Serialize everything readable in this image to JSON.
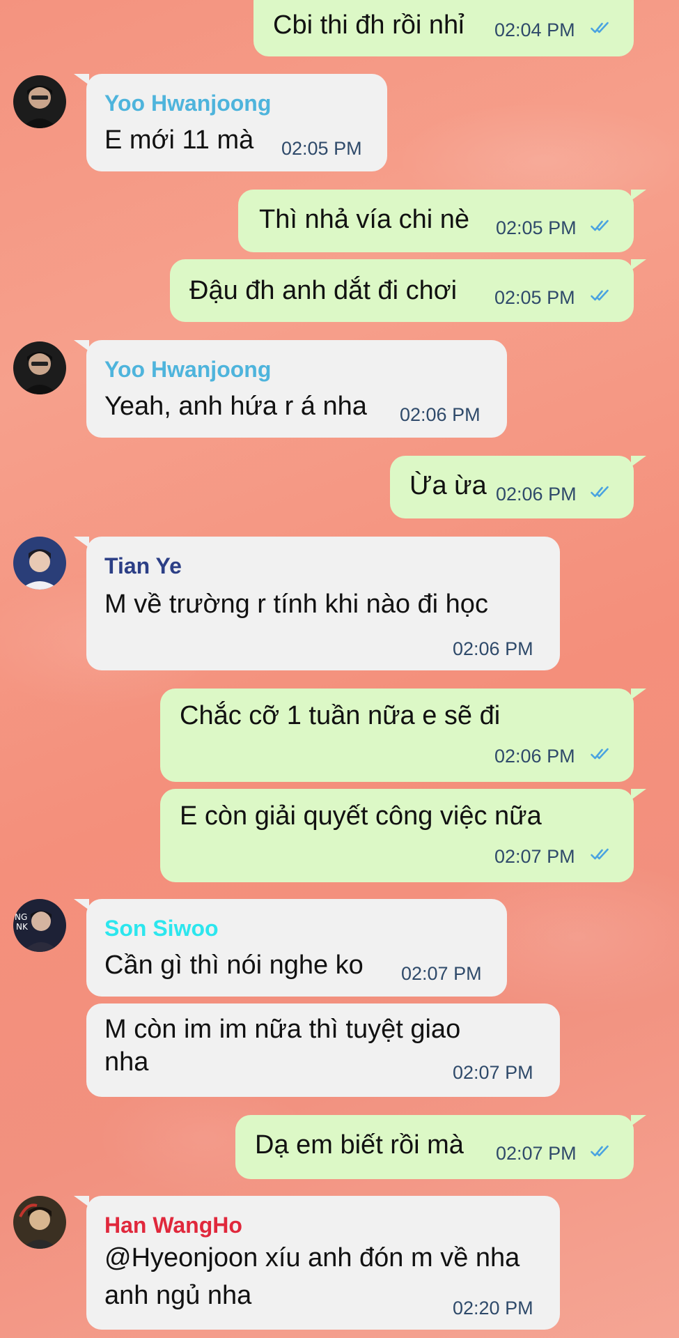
{
  "colors": {
    "outgoing_bubble": "#dcf8c6",
    "incoming_bubble": "#f1f1f1",
    "time_text": "#2f4a6a",
    "read_tick": "#4aa3e0",
    "name_yoo": "#4eb4dc",
    "name_tian": "#2c3f86",
    "name_son": "#2ce6ee",
    "name_han": "#e0283c"
  },
  "senders": {
    "yoo": "Yoo Hwanjoong",
    "tian": "Tian Ye",
    "son": "Son Siwoo",
    "han": "Han WangHo"
  },
  "messages": [
    {
      "text": "Cbi thi đh rồi nhỉ",
      "time": "02:04 PM",
      "icon": "double-check-icon"
    },
    {
      "text": "E mới 11 mà",
      "time": "02:05 PM"
    },
    {
      "text": "Thì nhả vía chi nè",
      "time": "02:05 PM",
      "icon": "double-check-icon"
    },
    {
      "text": "Đậu đh anh dắt đi chơi",
      "time": "02:05 PM",
      "icon": "double-check-icon"
    },
    {
      "text": "Yeah, anh hứa r á nha",
      "time": "02:06 PM"
    },
    {
      "text": "Ừa ừa",
      "time": "02:06 PM",
      "icon": "double-check-icon"
    },
    {
      "text": "M về trường r tính khi nào đi học",
      "time": "02:06 PM"
    },
    {
      "text": "Chắc cỡ 1 tuần nữa e sẽ đi",
      "time": "02:06 PM",
      "icon": "double-check-icon"
    },
    {
      "text": "E còn giải quyết công việc nữa",
      "time": "02:07 PM",
      "icon": "double-check-icon"
    },
    {
      "text": "Cần gì thì nói nghe ko",
      "time": "02:07 PM"
    },
    {
      "text": "M còn im im nữa thì tuyệt giao nha",
      "time": "02:07 PM"
    },
    {
      "text": "Dạ em biết rồi mà",
      "time": "02:07 PM",
      "icon": "double-check-icon"
    },
    {
      "text": "@Hyeonjoon xíu anh đón m về nha anh ngủ nha",
      "time": "02:20 PM"
    }
  ]
}
